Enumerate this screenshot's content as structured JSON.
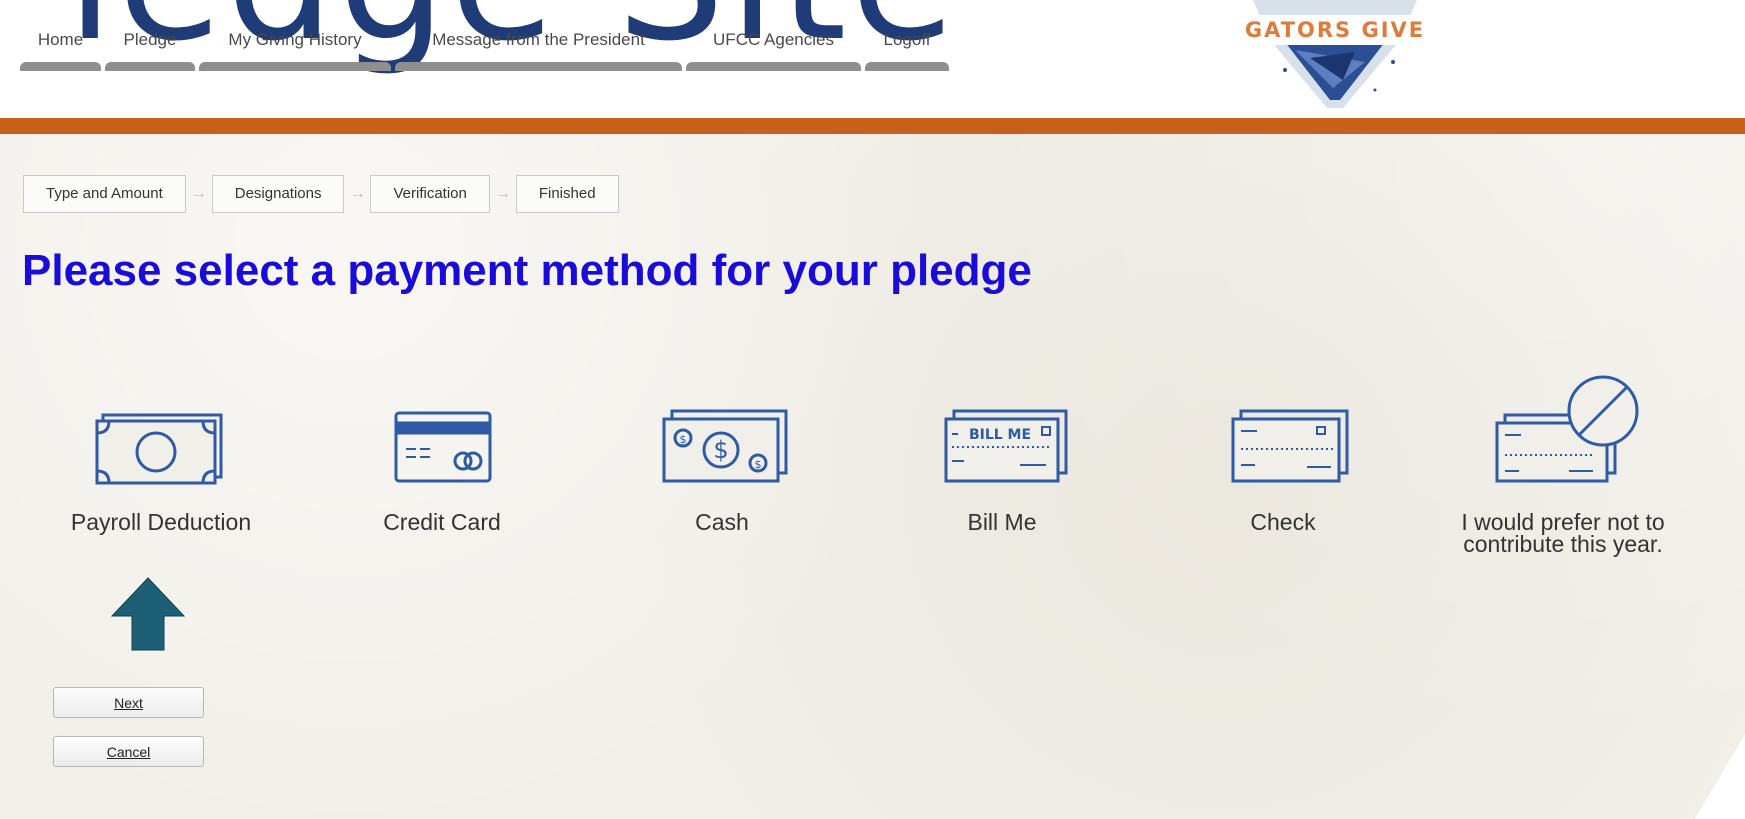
{
  "header": {
    "banner_text": "Pledge Site",
    "nav": [
      {
        "label": "Home",
        "width": 81
      },
      {
        "label": "Pledge",
        "width": 90
      },
      {
        "label": "My Giving History",
        "width": 192
      },
      {
        "label": "Message from the President",
        "width": 287
      },
      {
        "label": "UFCC Agencies",
        "width": 175
      },
      {
        "label": "Logoff",
        "width": 84
      }
    ],
    "logo_text": "GATORS GIVE"
  },
  "steps": [
    "Type and Amount",
    "Designations",
    "Verification",
    "Finished"
  ],
  "heading": "Please select a payment method for your pledge",
  "options": [
    {
      "label": "Payroll Deduction",
      "icon": "money-bill-icon"
    },
    {
      "label": "Credit Card",
      "icon": "credit-card-icon"
    },
    {
      "label": "Cash",
      "icon": "cash-icon"
    },
    {
      "label": "Bill Me",
      "icon": "bill-me-icon",
      "icon_text": "BILL ME"
    },
    {
      "label": "Check",
      "icon": "check-icon"
    },
    {
      "label": "I would prefer not to contribute this year.",
      "icon": "no-contribution-icon"
    }
  ],
  "buttons": {
    "next": "Next",
    "cancel": "Cancel"
  },
  "colors": {
    "orange": "#c8601c",
    "heading": "#1a0bd8",
    "icon": "#2f5aa6",
    "arrow": "#1d5f75",
    "navy": "#1f3b78"
  }
}
